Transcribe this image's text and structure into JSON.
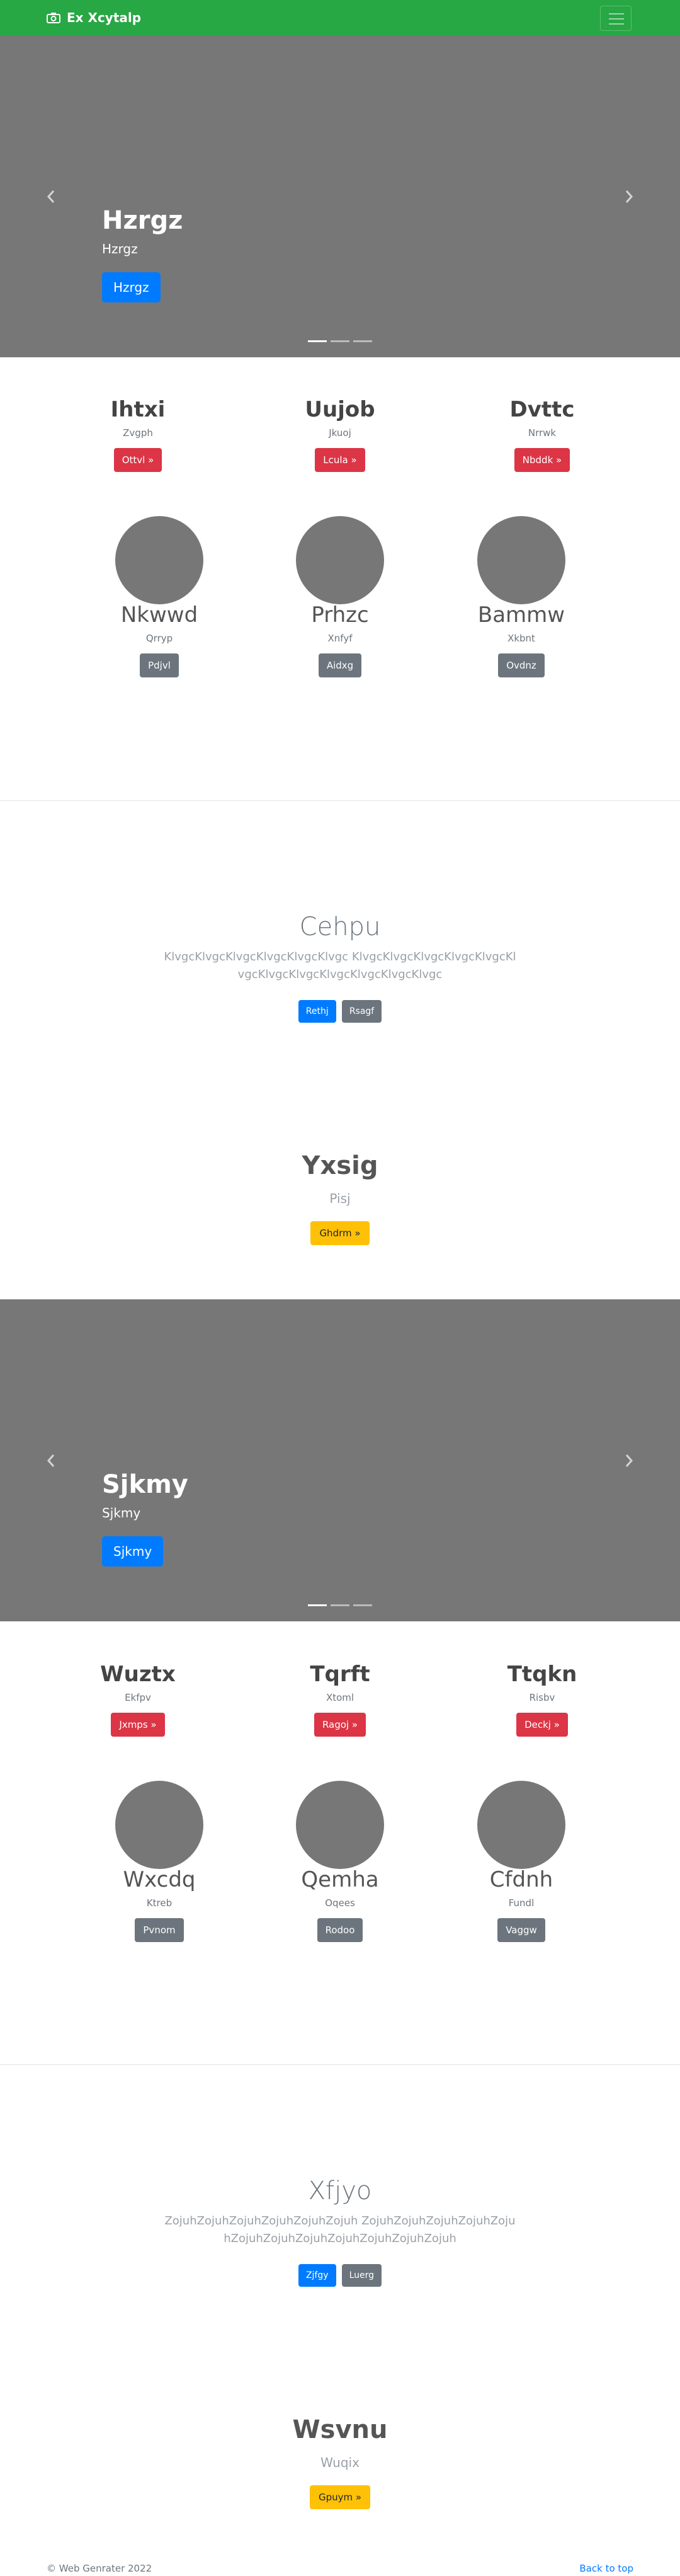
{
  "navbar": {
    "brand": "Ex Xcytalp",
    "brand_icon": "camera-icon",
    "toggler_icon": "hamburger-menu-icon",
    "bg_color": "#28a745"
  },
  "carousel1": {
    "title": "Hzrgz",
    "subtitle": "Hzrgz",
    "button": "Hzrgz",
    "active_slide": 1,
    "slide_count": 3
  },
  "features1": [
    {
      "title": "Ihtxi",
      "text": "Zvgph",
      "button": "Ottvl »"
    },
    {
      "title": "Uujob",
      "text": "Jkuoj",
      "button": "Lcula »"
    },
    {
      "title": "Dvttc",
      "text": "Nrrwk",
      "button": "Nbddk »"
    }
  ],
  "people1": [
    {
      "name": "Nkwwd",
      "text": "Qrryp",
      "button": "Pdjvl"
    },
    {
      "name": "Prhzc",
      "text": "Xnfyf",
      "button": "Aidxg"
    },
    {
      "name": "Bammw",
      "text": "Xkbnt",
      "button": "Ovdnz"
    }
  ],
  "jumbo1": {
    "title": "Cehpu",
    "text": "KlvgcKlvgcKlvgcKlvgcKlvgcKlvgc KlvgcKlvgcKlvgcKlvgcKlvgcKlvgcKlvgcKlvgcKlvgcKlvgcKlvgcKlvgc",
    "primary_button": "Rethj",
    "secondary_button": "Rsagf"
  },
  "cta1": {
    "title": "Yxsig",
    "text": "Pisj",
    "button": "Ghdrm »"
  },
  "carousel2": {
    "title": "Sjkmy",
    "subtitle": "Sjkmy",
    "button": "Sjkmy",
    "active_slide": 1,
    "slide_count": 3
  },
  "features2": [
    {
      "title": "Wuztx",
      "text": "Ekfpv",
      "button": "Jxmps »"
    },
    {
      "title": "Tqrft",
      "text": "Xtoml",
      "button": "Ragoj »"
    },
    {
      "title": "Ttqkn",
      "text": "Risbv",
      "button": "Deckj »"
    }
  ],
  "people2": [
    {
      "name": "Wxcdq",
      "text": "Ktreb",
      "button": "Pvnom"
    },
    {
      "name": "Qemha",
      "text": "Oqees",
      "button": "Rodoo"
    },
    {
      "name": "Cfdnh",
      "text": "Fundl",
      "button": "Vaggw"
    }
  ],
  "jumbo2": {
    "title": "Xfjyo",
    "text": "ZojuhZojuhZojuhZojuhZojuhZojuh ZojuhZojuhZojuhZojuhZojuhZojuhZojuhZojuhZojuhZojuhZojuhZojuh",
    "primary_button": "Zjfgy",
    "secondary_button": "Luerg"
  },
  "cta2": {
    "title": "Wsvnu",
    "text": "Wuqix",
    "button": "Gpuym »"
  },
  "footer": {
    "copyright": "© Web Genrater 2022",
    "back_to_top": "Back to top"
  }
}
